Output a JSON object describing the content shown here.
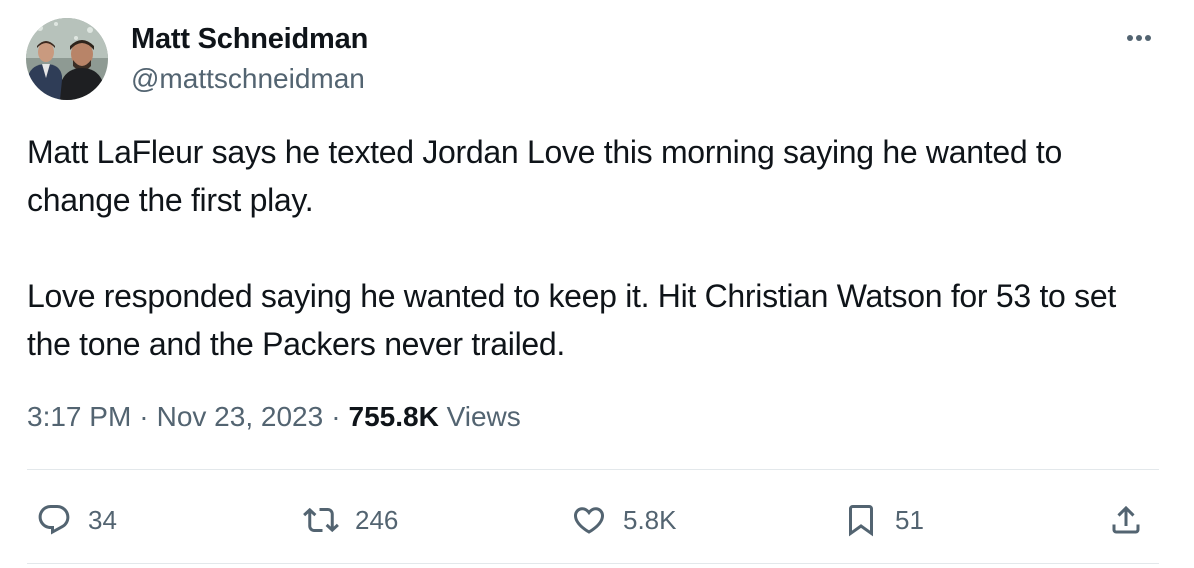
{
  "author": {
    "name": "Matt Schneidman",
    "handle": "@mattschneidman"
  },
  "tweet": {
    "paragraphs": [
      "Matt LaFleur says he texted Jordan Love this morning saying he wanted to change the first play.",
      "Love responded saying he wanted to keep it. Hit Christian Watson for 53 to set the tone and the Packers never trailed."
    ],
    "time": "3:17 PM",
    "separator": "·",
    "date": "Nov 23, 2023",
    "views_count": "755.8K",
    "views_label": "Views"
  },
  "actions": {
    "replies": "34",
    "retweets": "246",
    "likes": "5.8K",
    "bookmarks": "51"
  },
  "icons": {
    "more": "more-dots-icon",
    "reply": "reply-bubble-icon",
    "retweet": "retweet-icon",
    "like": "heart-icon",
    "bookmark": "bookmark-icon",
    "share": "share-upload-icon"
  },
  "colors": {
    "text_primary": "#0f1419",
    "text_secondary": "#536471",
    "divider": "#e3e8eb"
  }
}
